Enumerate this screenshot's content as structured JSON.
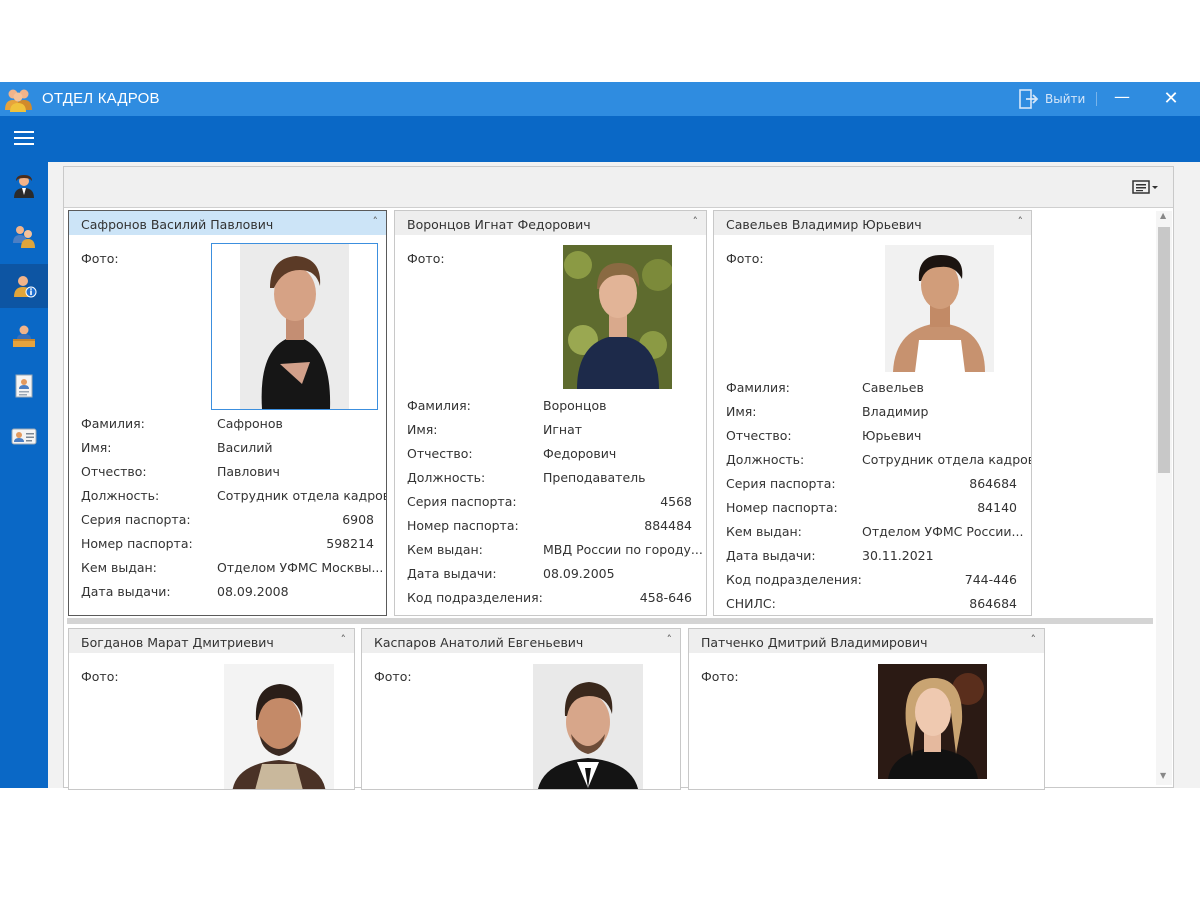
{
  "app": {
    "title": "ОТДЕЛ КАДРОВ",
    "logout_label": "Выйти",
    "minimize": "—",
    "close": "✕"
  },
  "nav": {
    "items": [
      "person-icon",
      "group-icon",
      "person-info-icon",
      "desk-icon",
      "document-icon",
      "id-card-icon"
    ],
    "active_index": 2
  },
  "labels": {
    "photo": "Фото:",
    "surname": "Фамилия:",
    "name": "Имя:",
    "patronymic": "Отчество:",
    "position": "Должность:",
    "passport_series": "Серия паспорта:",
    "passport_number": "Номер паспорта:",
    "issued_by": "Кем выдан:",
    "issue_date": "Дата выдачи:",
    "division_code": "Код подразделения:",
    "snils": "СНИЛС:"
  },
  "cards": [
    {
      "title": "Сафронов Василий Павлович",
      "surname": "Сафронов",
      "name": "Василий",
      "patronymic": "Павлович",
      "position": "Сотрудник отдела кадров",
      "passport_series": "6908",
      "passport_number": "598214",
      "issued_by": "Отделом УФМС Москвы...",
      "issue_date": "08.09.2008",
      "selected": true
    },
    {
      "title": "Воронцов Игнат Федорович",
      "surname": "Воронцов",
      "name": "Игнат",
      "patronymic": "Федорович",
      "position": "Преподаватель",
      "passport_series": "4568",
      "passport_number": "884484",
      "issued_by": "МВД России по городу...",
      "issue_date": "08.09.2005",
      "division_code": "458-646"
    },
    {
      "title": "Савельев Владимир Юрьевич",
      "surname": "Савельев",
      "name": "Владимир",
      "patronymic": "Юрьевич",
      "position": "Сотрудник отдела кадров",
      "passport_series": "864684",
      "passport_number": "84140",
      "issued_by": "Отделом УФМС России...",
      "issue_date": "30.11.2021",
      "division_code": "744-446",
      "snils": "864684"
    },
    {
      "title": "Богданов Марат Дмитриевич"
    },
    {
      "title": "Каспаров Анатолий Евгеньевич"
    },
    {
      "title": "Патченко Дмитрий Владимирович"
    }
  ],
  "colors": {
    "titlebar": "#2f8ce0",
    "toolbar": "#0a68c6",
    "selected_header": "#cce4f7",
    "selection_border": "#3c8fde"
  }
}
